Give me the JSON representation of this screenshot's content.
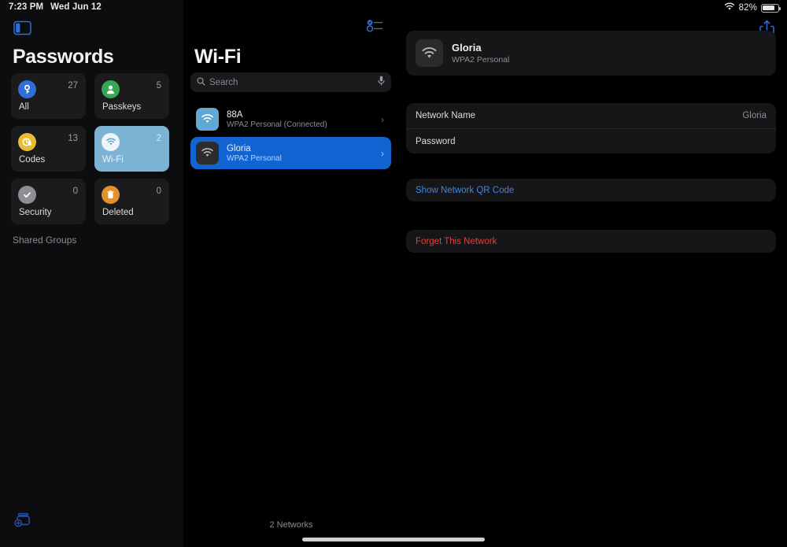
{
  "status_bar": {
    "time": "7:23 PM",
    "date": "Wed Jun 12",
    "battery_percent": "82%",
    "wifi_icon": "wifi-icon",
    "battery_icon": "battery-icon"
  },
  "sidebar": {
    "toggle_icon": "sidebar-toggle-icon",
    "title": "Passwords",
    "tiles": [
      {
        "label": "All",
        "count": "27",
        "icon": "key-icon",
        "color": "#2f6fd8",
        "selected": false
      },
      {
        "label": "Passkeys",
        "count": "5",
        "icon": "person-icon",
        "color": "#34a853",
        "selected": false
      },
      {
        "label": "Codes",
        "count": "13",
        "icon": "clock-lock-icon",
        "color": "#e8bd33",
        "selected": false
      },
      {
        "label": "Wi-Fi",
        "count": "2",
        "icon": "wifi-icon",
        "color": "#ffffff",
        "selected": true
      },
      {
        "label": "Security",
        "count": "0",
        "icon": "checkmark-icon",
        "color": "#8e8e93",
        "selected": false
      },
      {
        "label": "Deleted",
        "count": "0",
        "icon": "trash-icon",
        "color": "#e0922f",
        "selected": false
      }
    ],
    "shared_groups_label": "Shared Groups",
    "new_shared_group_icon": "new-shared-group-icon",
    "selected_tile_bg": "#7cb3d4"
  },
  "list_column": {
    "sort_icon": "sort-list-icon",
    "multitask_icon": "multitasking-dots-icon",
    "title": "Wi-Fi",
    "search": {
      "placeholder": "Search",
      "value": "",
      "search_icon": "search-icon",
      "mic_icon": "microphone-icon"
    },
    "networks": [
      {
        "name": "88A",
        "subtitle": "WPA2 Personal (Connected)",
        "icon": "wifi-icon",
        "icon_bg": "#62a8d4",
        "selected": false
      },
      {
        "name": "Gloria",
        "subtitle": "WPA2 Personal",
        "icon": "wifi-icon",
        "icon_bg": "#2c2c2e",
        "selected": true
      }
    ],
    "footer_count": "2 Networks",
    "selection_color": "#1264d3"
  },
  "detail": {
    "share_icon": "share-icon",
    "header": {
      "name": "Gloria",
      "subtitle": "WPA2 Personal",
      "icon": "wifi-icon"
    },
    "fields": [
      {
        "label": "Network Name",
        "value": "Gloria"
      },
      {
        "label": "Password",
        "value": ""
      }
    ],
    "qr_action_label": "Show Network QR Code",
    "forget_action_label": "Forget This Network",
    "accent_blue": "#3f86e8",
    "danger_red": "#d9443f"
  }
}
